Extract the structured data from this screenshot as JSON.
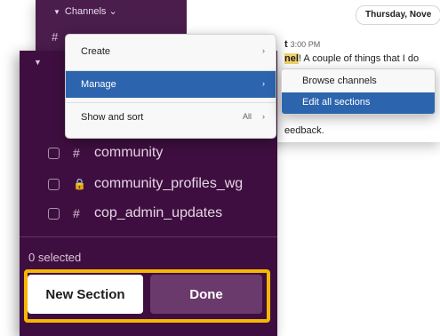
{
  "background_window": {
    "channels_header": "Channels",
    "date_pill": "Thursday, Nove",
    "message_time": "3:00 PM",
    "message_time_prefix": "t",
    "message_highlight": "nel",
    "message_text": "! A couple of things that I do",
    "message_feedback": "eedback."
  },
  "sidebar": {
    "channels": [
      {
        "icon": "#",
        "label": "community"
      },
      {
        "icon": "🔒",
        "label": "community_profiles_wg"
      },
      {
        "icon": "#",
        "label": "cop_admin_updates"
      }
    ],
    "selected_count": "0 selected",
    "new_section_label": "New Section",
    "done_label": "Done"
  },
  "menu": {
    "items": [
      {
        "label": "Create",
        "shortcut": "",
        "arrow": "›"
      },
      {
        "label": "Manage",
        "shortcut": "",
        "arrow": "›"
      },
      {
        "label": "Show and sort",
        "shortcut": "All",
        "arrow": "›"
      }
    ]
  },
  "submenu": {
    "items": [
      {
        "label": "Browse channels"
      },
      {
        "label": "Edit all sections"
      }
    ]
  },
  "colors": {
    "sidebar_bg": "#3f0e40",
    "highlight_frame": "#f5b700",
    "menu_active": "#2c65ad",
    "done_button": "#6b3a6c"
  }
}
